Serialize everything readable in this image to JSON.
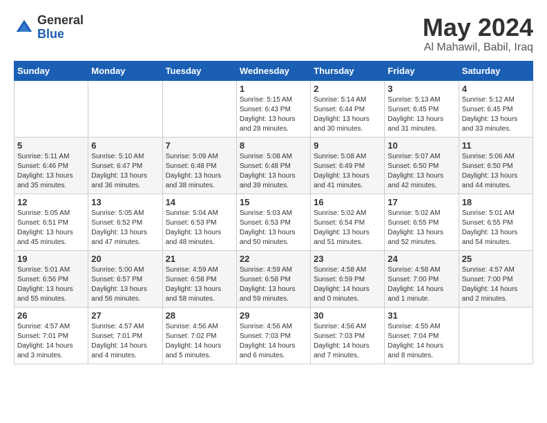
{
  "logo": {
    "general": "General",
    "blue": "Blue"
  },
  "title": "May 2024",
  "subtitle": "Al Mahawil, Babil, Iraq",
  "days_of_week": [
    "Sunday",
    "Monday",
    "Tuesday",
    "Wednesday",
    "Thursday",
    "Friday",
    "Saturday"
  ],
  "weeks": [
    [
      {
        "day": "",
        "detail": ""
      },
      {
        "day": "",
        "detail": ""
      },
      {
        "day": "",
        "detail": ""
      },
      {
        "day": "1",
        "detail": "Sunrise: 5:15 AM\nSunset: 6:43 PM\nDaylight: 13 hours\nand 28 minutes."
      },
      {
        "day": "2",
        "detail": "Sunrise: 5:14 AM\nSunset: 6:44 PM\nDaylight: 13 hours\nand 30 minutes."
      },
      {
        "day": "3",
        "detail": "Sunrise: 5:13 AM\nSunset: 6:45 PM\nDaylight: 13 hours\nand 31 minutes."
      },
      {
        "day": "4",
        "detail": "Sunrise: 5:12 AM\nSunset: 6:45 PM\nDaylight: 13 hours\nand 33 minutes."
      }
    ],
    [
      {
        "day": "5",
        "detail": "Sunrise: 5:11 AM\nSunset: 6:46 PM\nDaylight: 13 hours\nand 35 minutes."
      },
      {
        "day": "6",
        "detail": "Sunrise: 5:10 AM\nSunset: 6:47 PM\nDaylight: 13 hours\nand 36 minutes."
      },
      {
        "day": "7",
        "detail": "Sunrise: 5:09 AM\nSunset: 6:48 PM\nDaylight: 13 hours\nand 38 minutes."
      },
      {
        "day": "8",
        "detail": "Sunrise: 5:08 AM\nSunset: 6:48 PM\nDaylight: 13 hours\nand 39 minutes."
      },
      {
        "day": "9",
        "detail": "Sunrise: 5:08 AM\nSunset: 6:49 PM\nDaylight: 13 hours\nand 41 minutes."
      },
      {
        "day": "10",
        "detail": "Sunrise: 5:07 AM\nSunset: 6:50 PM\nDaylight: 13 hours\nand 42 minutes."
      },
      {
        "day": "11",
        "detail": "Sunrise: 5:06 AM\nSunset: 6:50 PM\nDaylight: 13 hours\nand 44 minutes."
      }
    ],
    [
      {
        "day": "12",
        "detail": "Sunrise: 5:05 AM\nSunset: 6:51 PM\nDaylight: 13 hours\nand 45 minutes."
      },
      {
        "day": "13",
        "detail": "Sunrise: 5:05 AM\nSunset: 6:52 PM\nDaylight: 13 hours\nand 47 minutes."
      },
      {
        "day": "14",
        "detail": "Sunrise: 5:04 AM\nSunset: 6:53 PM\nDaylight: 13 hours\nand 48 minutes."
      },
      {
        "day": "15",
        "detail": "Sunrise: 5:03 AM\nSunset: 6:53 PM\nDaylight: 13 hours\nand 50 minutes."
      },
      {
        "day": "16",
        "detail": "Sunrise: 5:02 AM\nSunset: 6:54 PM\nDaylight: 13 hours\nand 51 minutes."
      },
      {
        "day": "17",
        "detail": "Sunrise: 5:02 AM\nSunset: 6:55 PM\nDaylight: 13 hours\nand 52 minutes."
      },
      {
        "day": "18",
        "detail": "Sunrise: 5:01 AM\nSunset: 6:55 PM\nDaylight: 13 hours\nand 54 minutes."
      }
    ],
    [
      {
        "day": "19",
        "detail": "Sunrise: 5:01 AM\nSunset: 6:56 PM\nDaylight: 13 hours\nand 55 minutes."
      },
      {
        "day": "20",
        "detail": "Sunrise: 5:00 AM\nSunset: 6:57 PM\nDaylight: 13 hours\nand 56 minutes."
      },
      {
        "day": "21",
        "detail": "Sunrise: 4:59 AM\nSunset: 6:58 PM\nDaylight: 13 hours\nand 58 minutes."
      },
      {
        "day": "22",
        "detail": "Sunrise: 4:59 AM\nSunset: 6:58 PM\nDaylight: 13 hours\nand 59 minutes."
      },
      {
        "day": "23",
        "detail": "Sunrise: 4:58 AM\nSunset: 6:59 PM\nDaylight: 14 hours\nand 0 minutes."
      },
      {
        "day": "24",
        "detail": "Sunrise: 4:58 AM\nSunset: 7:00 PM\nDaylight: 14 hours\nand 1 minute."
      },
      {
        "day": "25",
        "detail": "Sunrise: 4:57 AM\nSunset: 7:00 PM\nDaylight: 14 hours\nand 2 minutes."
      }
    ],
    [
      {
        "day": "26",
        "detail": "Sunrise: 4:57 AM\nSunset: 7:01 PM\nDaylight: 14 hours\nand 3 minutes."
      },
      {
        "day": "27",
        "detail": "Sunrise: 4:57 AM\nSunset: 7:01 PM\nDaylight: 14 hours\nand 4 minutes."
      },
      {
        "day": "28",
        "detail": "Sunrise: 4:56 AM\nSunset: 7:02 PM\nDaylight: 14 hours\nand 5 minutes."
      },
      {
        "day": "29",
        "detail": "Sunrise: 4:56 AM\nSunset: 7:03 PM\nDaylight: 14 hours\nand 6 minutes."
      },
      {
        "day": "30",
        "detail": "Sunrise: 4:56 AM\nSunset: 7:03 PM\nDaylight: 14 hours\nand 7 minutes."
      },
      {
        "day": "31",
        "detail": "Sunrise: 4:55 AM\nSunset: 7:04 PM\nDaylight: 14 hours\nand 8 minutes."
      },
      {
        "day": "",
        "detail": ""
      }
    ]
  ]
}
